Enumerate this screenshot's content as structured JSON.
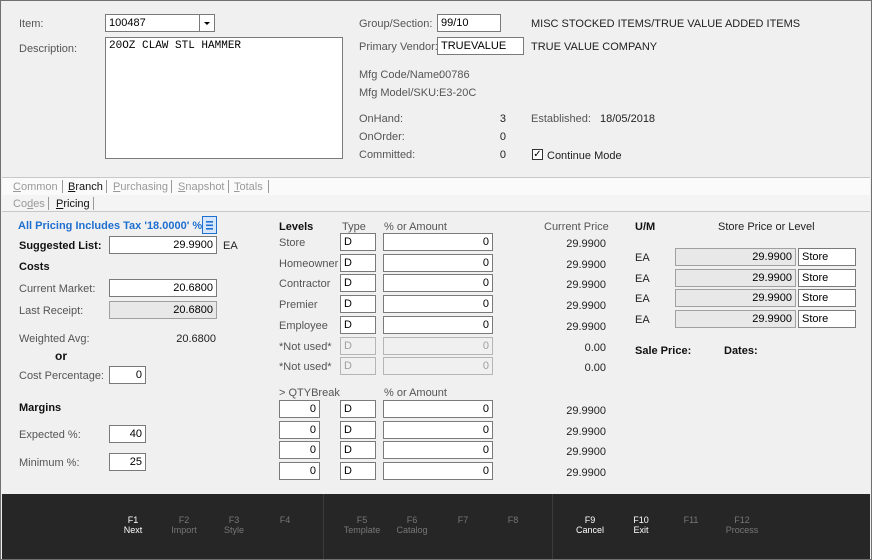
{
  "header": {
    "item_label": "Item:",
    "item_value": "100487",
    "description_label": "Description:",
    "description_value": "20OZ CLAW STL HAMMER",
    "group_label": "Group/Section:",
    "group_value": "99/10",
    "group_desc": "MISC STOCKED ITEMS/TRUE VALUE ADDED ITEMS",
    "vendor_label": "Primary Vendor:",
    "vendor_value": "TRUEVALUE",
    "vendor_desc": "TRUE VALUE COMPANY",
    "mfg_code_label": "Mfg Code/Name:",
    "mfg_code_value": "00786",
    "mfg_model_label": "Mfg Model/SKU:",
    "mfg_model_value": "E3-20C",
    "onhand_label": "OnHand:",
    "onhand_value": "3",
    "onorder_label": "OnOrder:",
    "onorder_value": "0",
    "committed_label": "Committed:",
    "committed_value": "0",
    "established_label": "Established:",
    "established_value": "18/05/2018",
    "continue_mode_label": "Continue Mode",
    "continue_mode_checked": true
  },
  "tabs_top": [
    {
      "pre": "",
      "u": "C",
      "post": "ommon"
    },
    {
      "pre": "",
      "u": "B",
      "post": "ranch"
    },
    {
      "pre": "",
      "u": "P",
      "post": "urchasing"
    },
    {
      "pre": "",
      "u": "S",
      "post": "napshot"
    },
    {
      "pre": "",
      "u": "T",
      "post": "otals"
    }
  ],
  "tabs_sub": [
    {
      "pre": "Co",
      "u": "d",
      "post": "es"
    },
    {
      "pre": "",
      "u": "P",
      "post": "ricing"
    }
  ],
  "pricing": {
    "tax_note": "All Pricing Includes Tax '18.0000'  %",
    "suggested_list_label": "Suggested List:",
    "suggested_list_value": "29.9900",
    "suggested_list_uom": "EA",
    "costs_heading": "Costs",
    "current_market_label": "Current Market:",
    "current_market_value": "20.6800",
    "last_receipt_label": "Last Receipt:",
    "last_receipt_value": "20.6800",
    "weighted_avg_label": "Weighted Avg:",
    "weighted_avg_value": "20.6800",
    "or_label": "or",
    "cost_pct_label": "Cost Percentage:",
    "cost_pct_value": "0",
    "margins_heading": "Margins",
    "expected_label": "Expected %:",
    "expected_value": "40",
    "minimum_label": "Minimum %:",
    "minimum_value": "25"
  },
  "levels": {
    "heading": "Levels",
    "type_header": "Type",
    "amount_header": "% or Amount",
    "current_price_header": "Current Price",
    "rows": [
      {
        "name": "Store",
        "type": "D",
        "amount": "0",
        "price": "29.9900",
        "disabled": false
      },
      {
        "name": "Homeowner",
        "type": "D",
        "amount": "0",
        "price": "29.9900",
        "disabled": false
      },
      {
        "name": "Contractor",
        "type": "D",
        "amount": "0",
        "price": "29.9900",
        "disabled": false
      },
      {
        "name": "Premier",
        "type": "D",
        "amount": "0",
        "price": "29.9900",
        "disabled": false
      },
      {
        "name": "Employee",
        "type": "D",
        "amount": "0",
        "price": "29.9900",
        "disabled": false
      },
      {
        "name": "*Not used*",
        "type": "D",
        "amount": "0",
        "price": "0.00",
        "disabled": true
      },
      {
        "name": "*Not used*",
        "type": "D",
        "amount": "0",
        "price": "0.00",
        "disabled": true
      }
    ],
    "qty_header": "> QTYBreak",
    "qty_amount_header": "% or Amount",
    "qty_rows": [
      {
        "qty": "0",
        "type": "D",
        "amount": "0",
        "price": "29.9900"
      },
      {
        "qty": "0",
        "type": "D",
        "amount": "0",
        "price": "29.9900"
      },
      {
        "qty": "0",
        "type": "D",
        "amount": "0",
        "price": "29.9900"
      },
      {
        "qty": "0",
        "type": "D",
        "amount": "0",
        "price": "29.9900"
      }
    ]
  },
  "uom": {
    "um_header": "U/M",
    "store_header": "Store Price or Level",
    "rows": [
      {
        "um": "EA",
        "price": "29.9900",
        "level": "Store"
      },
      {
        "um": "EA",
        "price": "29.9900",
        "level": "Store"
      },
      {
        "um": "EA",
        "price": "29.9900",
        "level": "Store"
      },
      {
        "um": "EA",
        "price": "29.9900",
        "level": "Store"
      }
    ],
    "sale_price_label": "Sale Price:",
    "dates_label": "Dates:"
  },
  "fkeys": [
    {
      "key": "F1",
      "label": "Next",
      "enabled": true
    },
    {
      "key": "F2",
      "label": "Import",
      "enabled": false
    },
    {
      "key": "F3",
      "label": "Style",
      "enabled": false
    },
    {
      "key": "F4",
      "label": "",
      "enabled": false
    },
    {
      "key": "F5",
      "label": "Template",
      "enabled": false
    },
    {
      "key": "F6",
      "label": "Catalog",
      "enabled": false
    },
    {
      "key": "F7",
      "label": "",
      "enabled": false
    },
    {
      "key": "F8",
      "label": "",
      "enabled": false
    },
    {
      "key": "F9",
      "label": "Cancel",
      "enabled": true
    },
    {
      "key": "F10",
      "label": "Exit",
      "enabled": true
    },
    {
      "key": "F11",
      "label": "",
      "enabled": false
    },
    {
      "key": "F12",
      "label": "Process",
      "enabled": false
    }
  ],
  "colors": {
    "accent": "#1e6fd0",
    "fbar_bg": "#262626"
  },
  "icons": {
    "dropdown": "chevron-down-icon",
    "menu": "menu-icon",
    "check": "checkmark-icon"
  }
}
